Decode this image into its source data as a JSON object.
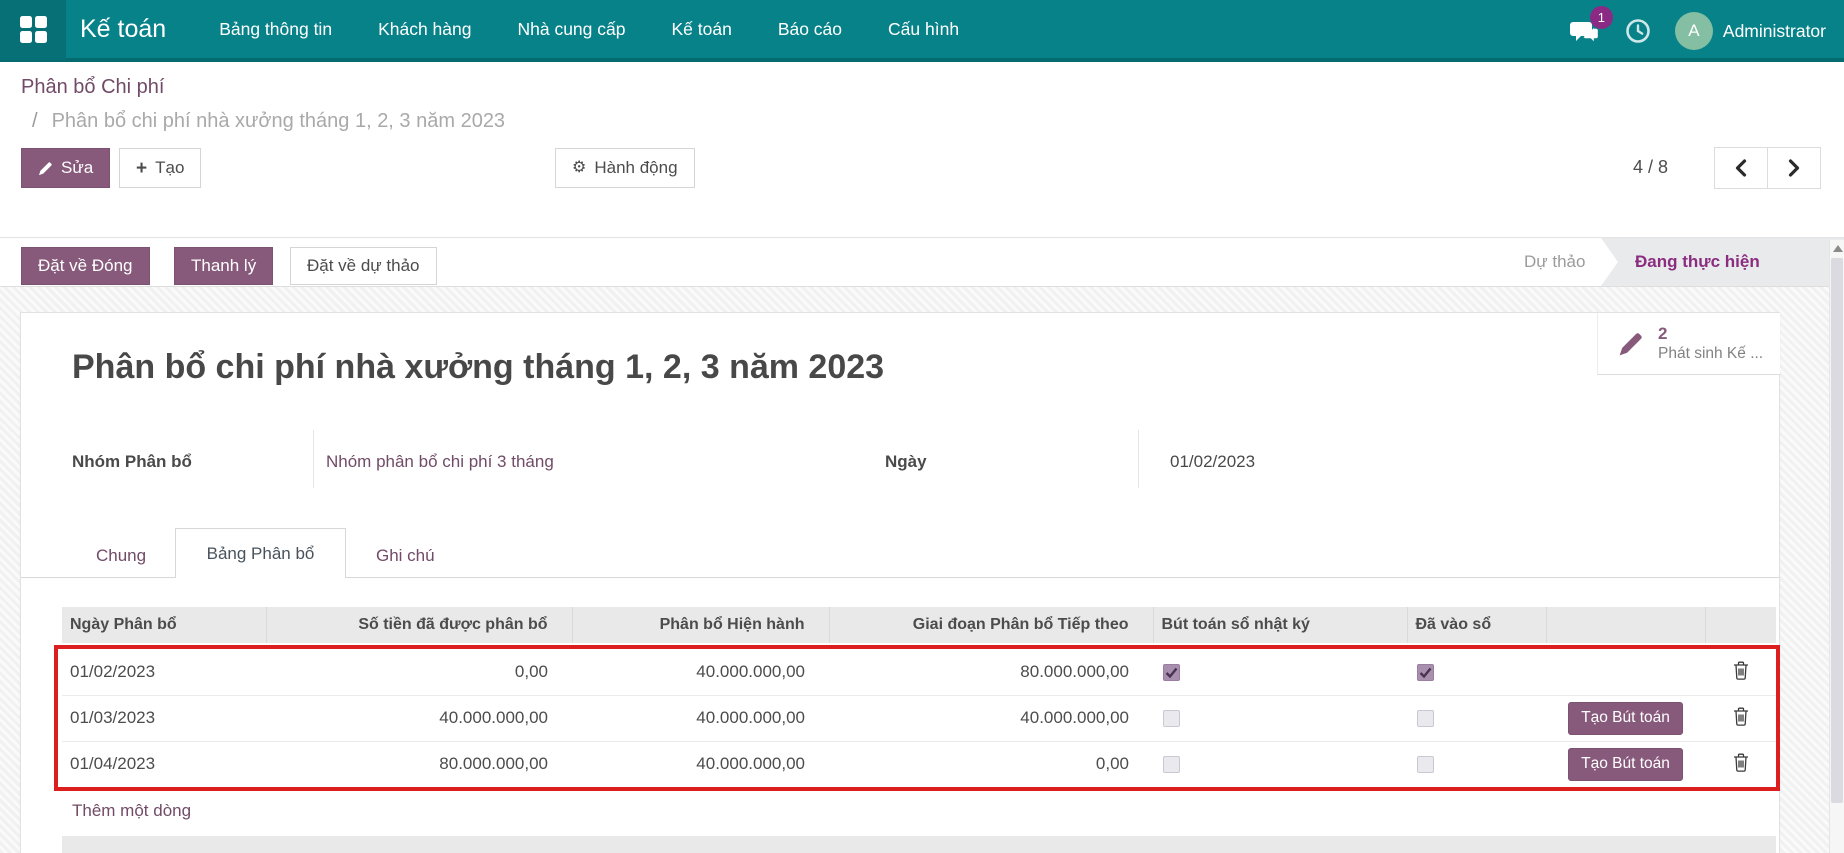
{
  "navbar": {
    "app_name": "Kế toán",
    "menu_items": [
      "Bảng thông tin",
      "Khách hàng",
      "Nhà cung cấp",
      "Kế toán",
      "Báo cáo",
      "Cấu hình"
    ],
    "message_badge": "1",
    "user_initial": "A",
    "user_name": "Administrator"
  },
  "breadcrumb": {
    "parent": "Phân bổ Chi phí",
    "separator": "/",
    "current": "Phân bổ chi phí nhà xưởng tháng 1, 2, 3 năm 2023"
  },
  "control_panel": {
    "edit_label": "Sửa",
    "create_label": "Tạo",
    "action_label": "Hành động",
    "pager": "4 / 8"
  },
  "icons": {
    "gear": "⚙",
    "plus": "+"
  },
  "statusbar": {
    "set_closed_label": "Đặt về Đóng",
    "liquidate_label": "Thanh lý",
    "set_draft_label": "Đặt về dự thảo",
    "state_draft": "Dự thảo",
    "state_running": "Đang thực hiện"
  },
  "sheet": {
    "smart_button": {
      "count": "2",
      "label": "Phát sinh Kế ..."
    },
    "title": "Phân bổ chi phí nhà xưởng tháng 1, 2, 3 năm 2023",
    "fields": {
      "group_label": "Nhóm Phân bổ",
      "group_value": "Nhóm phân bổ chi phí 3 tháng",
      "date_label": "Ngày",
      "date_value": "01/02/2023"
    },
    "tabs": {
      "general": "Chung",
      "allocation_table": "Bảng Phân bổ",
      "notes": "Ghi chú"
    },
    "table": {
      "columns": [
        "Ngày Phân bổ",
        "Số tiền đã được phân bổ",
        "Phân bổ Hiện hành",
        "Giai đoạn Phân bổ Tiếp theo",
        "Bút toán sổ nhật ký",
        "Đã vào sổ"
      ],
      "rows": [
        {
          "date": "01/02/2023",
          "allocated": "0,00",
          "current": "40.000.000,00",
          "next": "80.000.000,00",
          "journal_checked": true,
          "posted_checked": true,
          "action": null
        },
        {
          "date": "01/03/2023",
          "allocated": "40.000.000,00",
          "current": "40.000.000,00",
          "next": "40.000.000,00",
          "journal_checked": false,
          "posted_checked": false,
          "action": "Tạo Bút toán"
        },
        {
          "date": "01/04/2023",
          "allocated": "80.000.000,00",
          "current": "40.000.000,00",
          "next": "0,00",
          "journal_checked": false,
          "posted_checked": false,
          "action": "Tạo Bút toán"
        }
      ],
      "add_line_label": "Thêm một dòng"
    }
  },
  "colors": {
    "navbar_teal": "#088289",
    "accent_purple": "#875a7b",
    "link_purple": "#714b67",
    "state_active_purple": "#8b2d7f",
    "badge_magenta": "#8a2a84",
    "annotation_red": "#dc1e1e"
  }
}
